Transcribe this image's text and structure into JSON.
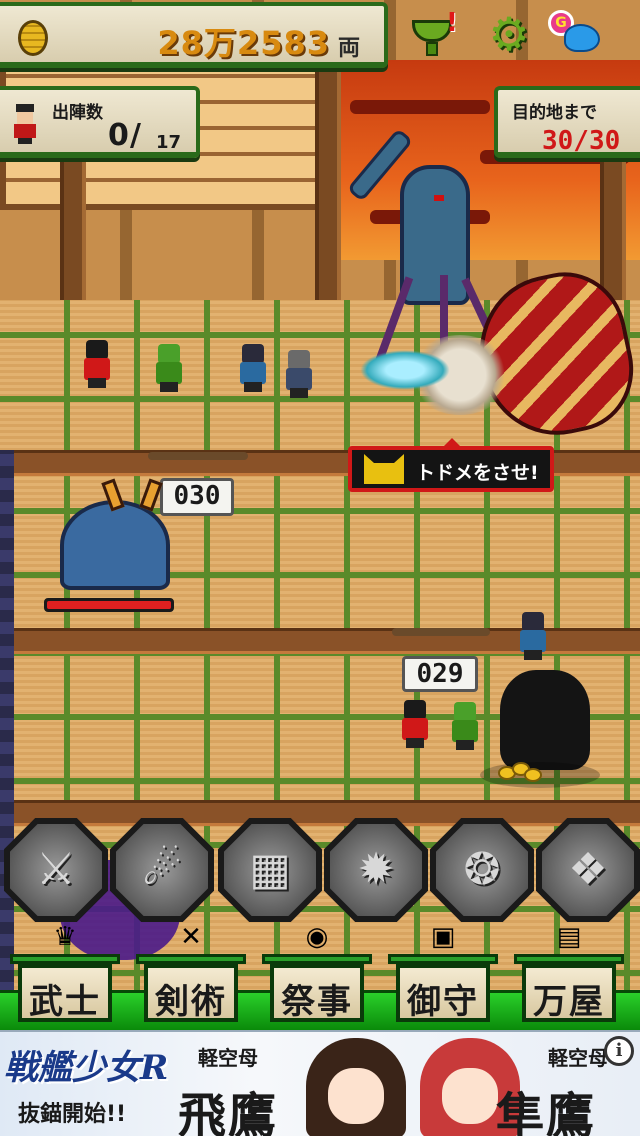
{
  "hud": {
    "money_value": "28万2583",
    "money_unit": "両",
    "deploy_label": "出陣数",
    "deploy_current": "0",
    "deploy_max": "17",
    "dest_label": "目的地まで",
    "dest_value": "30/30"
  },
  "top_icons": {
    "trophy_alert": "!",
    "share_badge": "G"
  },
  "counters": {
    "lane1": "030",
    "lane2": "029"
  },
  "popup": {
    "finish_text": "トドメをさせ!"
  },
  "enemy": {
    "hp_percent": 100
  },
  "skills": [
    {
      "icon": "katana-warrior-skill-icon",
      "glyph": "⚔"
    },
    {
      "icon": "ninja-dash-skill-icon",
      "glyph": "☄"
    },
    {
      "icon": "castle-skill-icon",
      "glyph": "▦"
    },
    {
      "icon": "bomb-skill-icon",
      "glyph": "✹"
    },
    {
      "icon": "lion-dance-skill-icon",
      "glyph": "❂"
    },
    {
      "icon": "shadow-beast-skill-icon",
      "glyph": "❖"
    }
  ],
  "menu": [
    {
      "label": "武士",
      "emblem": "helmet-crest-icon",
      "emblem_glyph": "♛"
    },
    {
      "label": "剣術",
      "emblem": "crossed-swords-icon",
      "emblem_glyph": "✕"
    },
    {
      "label": "祭事",
      "emblem": "festival-drum-icon",
      "emblem_glyph": "◉"
    },
    {
      "label": "御守",
      "emblem": "amulet-icon",
      "emblem_glyph": "▣"
    },
    {
      "label": "万屋",
      "emblem": "treasure-chest-icon",
      "emblem_glyph": "▤"
    }
  ],
  "ad": {
    "logo": "戦艦少女R",
    "sub": "抜錨開始!!",
    "small1": "軽空母",
    "big1": "飛鷹",
    "small2": "軽空母",
    "big2": "隼鷹",
    "info": "i"
  },
  "colors": {
    "hud_border": "#2a6a1a",
    "money_text": "#d88a10",
    "dest_text": "#d01818",
    "menu_green": "#2ad02a"
  }
}
